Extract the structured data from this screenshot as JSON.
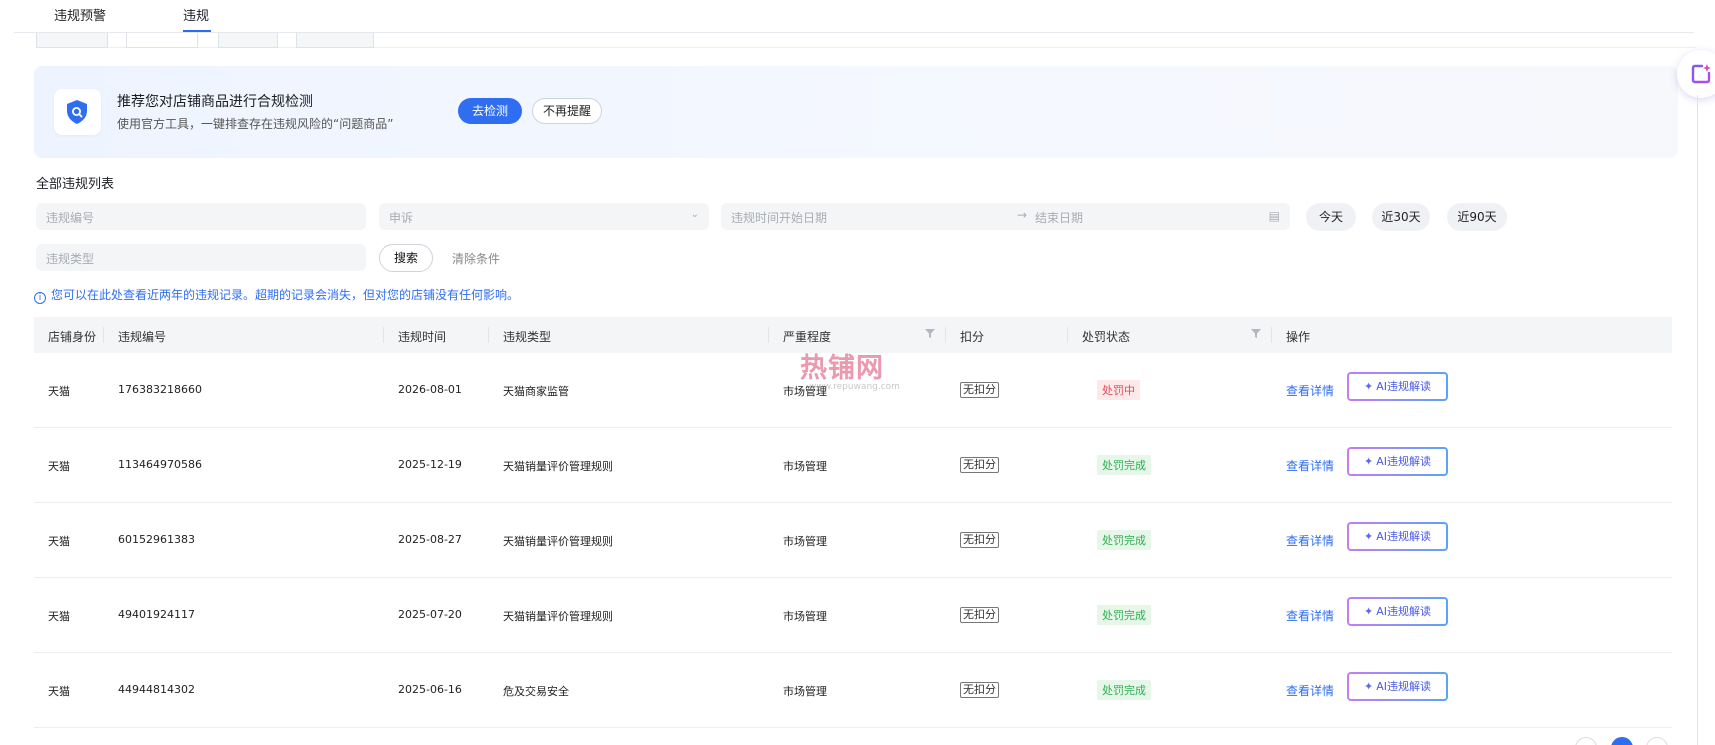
{
  "top_tabs": [
    {
      "label": "违规预警"
    },
    {
      "label": "违规"
    }
  ],
  "banner": {
    "title": "推荐您对店铺商品进行合规检测",
    "description": "使用官方工具，一键排查存在违规风险的“问题商品”",
    "primary_button": "去检测",
    "secondary_button": "不再提醒"
  },
  "list": {
    "title": "全部违规列表"
  },
  "filters": {
    "violation_number_placeholder": "违规编号",
    "appeal_placeholder": "申诉",
    "date_label": "违规时间",
    "start_date_placeholder": "开始日期",
    "end_date_placeholder": "结束日期",
    "violation_type_placeholder": "违规类型",
    "quick_ranges": [
      "今天",
      "近30天",
      "近90天"
    ],
    "search_label": "搜索",
    "clear_label": "清除条件"
  },
  "notice": "您可以在此处查看近两年的违规记录。超期的记录会消失，但对您的店铺没有任何影响。",
  "table": {
    "columns": [
      "店铺身份",
      "违规编号",
      "违规时间",
      "违规类型",
      "严重程度",
      "扣分",
      "处罚状态",
      "操作"
    ],
    "rows": [
      {
        "store": "天猫",
        "number": "176383218660",
        "date": "2026-08-01",
        "type": "天猫商家监管",
        "severity": "市场管理",
        "deduction": "无扣分",
        "status": "处罚中",
        "detail": "查看详情",
        "ai": "AI违规解读"
      },
      {
        "store": "天猫",
        "number": "113464970586",
        "date": "2025-12-19",
        "type": "天猫销量评价管理规则",
        "severity": "市场管理",
        "deduction": "无扣分",
        "status": "处罚完成",
        "detail": "查看详情",
        "ai": "AI违规解读"
      },
      {
        "store": "天猫",
        "number": "60152961383",
        "date": "2025-08-27",
        "type": "天猫销量评价管理规则",
        "severity": "市场管理",
        "deduction": "无扣分",
        "status": "处罚完成",
        "detail": "查看详情",
        "ai": "AI违规解读"
      },
      {
        "store": "天猫",
        "number": "49401924117",
        "date": "2025-07-20",
        "type": "天猫销量评价管理规则",
        "severity": "市场管理",
        "deduction": "无扣分",
        "status": "处罚完成",
        "detail": "查看详情",
        "ai": "AI违规解读"
      },
      {
        "store": "天猫",
        "number": "44944814302",
        "date": "2025-06-16",
        "type": "危及交易安全",
        "severity": "市场管理",
        "deduction": "无扣分",
        "status": "处罚完成",
        "detail": "查看详情",
        "ai": "AI违规解读"
      }
    ]
  },
  "watermark": {
    "text": "热铺网",
    "url": "www.repuwang.com"
  },
  "colors": {
    "accent": "#2f6ef0",
    "status_pending": "#e14b58",
    "status_done": "#2fae4e"
  }
}
